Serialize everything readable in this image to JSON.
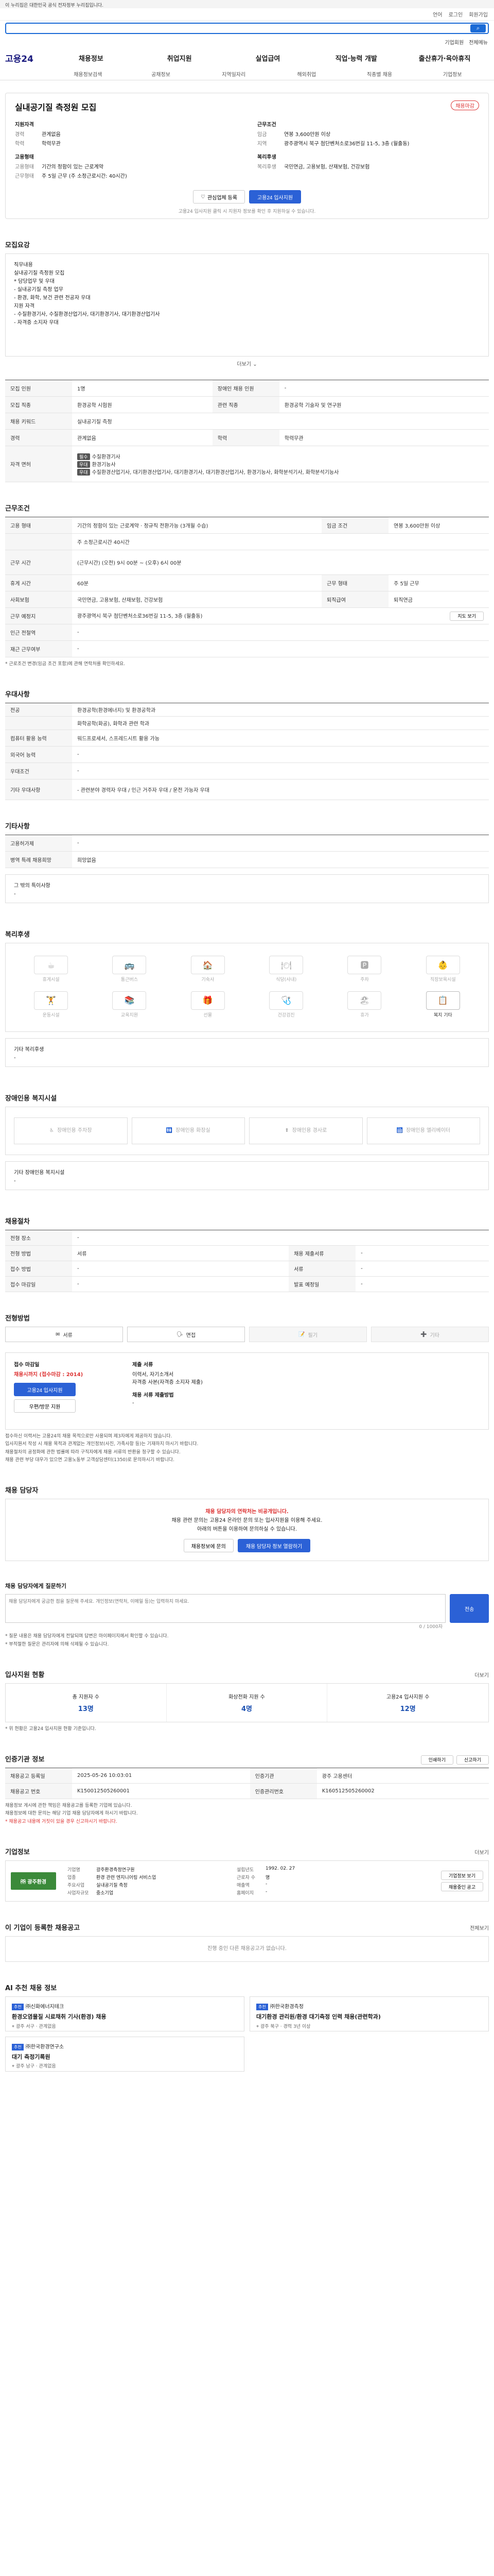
{
  "gov_bar": "이 누리집은 대한민국 공식 전자정부 누리집입니다.",
  "util": {
    "lang": "언어",
    "login": "로그인",
    "join": "회원가입"
  },
  "search": {
    "button": "검색"
  },
  "top_links": {
    "employer": "기업회원",
    "all_menu": "전체메뉴"
  },
  "logo": "고용24",
  "gnb": [
    "채용정보",
    "취업지원",
    "실업급여",
    "직업·능력 개발",
    "출산휴가·육아휴직"
  ],
  "lnb": [
    "채용정보검색",
    "공채정보",
    "지역일자리",
    "해외취업",
    "직종별 채용",
    "기업정보"
  ],
  "job": {
    "title": "실내공기질 측정원 모집",
    "status": "채용마감",
    "left_label": "지원자격",
    "right_label": "근무조건",
    "left_rows": [
      {
        "k": "경력",
        "v": "관계없음"
      },
      {
        "k": "학력",
        "v": "학력무관"
      }
    ],
    "right_rows": [
      {
        "k": "임금",
        "v": "연봉 3,600만원 이상"
      },
      {
        "k": "지역",
        "v": "광주광역시 북구 첨단벤처소로36번길 11-5, 3층 (월출동)"
      }
    ],
    "left_label2": "고용형태",
    "left_rows2": [
      {
        "k": "고용형태",
        "v": "기간의 정함이 있는 근로계약"
      },
      {
        "k": "근무형태",
        "v": "주 5일 근무 (주 소정근로시간: 40시간)"
      }
    ],
    "right_label2": "복리후생",
    "right_rows2": [
      {
        "k": "복리후생",
        "v": "국민연금, 고용보험, 산재보험, 건강보험"
      }
    ],
    "btn_interest": "관심업체 등록",
    "btn_apply": "고용24 입사지원",
    "note": "고용24 입사지원 클릭 시 지원자 정보를 확인 후 지원하실 수 있습니다."
  },
  "sections": {
    "detail": "모집요강",
    "work": "근무조건",
    "qualify": "우대사항",
    "other": "기타사항",
    "benefit": "복리후생",
    "disability": "장애인용 복지시설",
    "apply": "채용절차",
    "method": "전형방법",
    "inquiry": "채용 담당자",
    "question": "채용 담당자에게 질문하기",
    "status": "입사지원 현황",
    "info": "인증기관 정보",
    "company": "기업정보",
    "recommend": "이 기업이 등록한 채용공고",
    "ai": "AI 추천 채용 정보"
  },
  "detail_box": [
    "직무내용",
    "실내공기질 측정원 모집",
    "",
    "* 담당업무 및 우대",
    " - 실내공기질 측정 업무",
    " - 환경, 화학, 보건 관련 전공자 우대",
    "",
    "지원 자격",
    "- 수질환경기사, 수질환경산업기사, 대기환경기사, 대기환경산업기사",
    "- 자격증 소지자 우대"
  ],
  "more": "더보기",
  "table1": [
    {
      "k": "모집 인원",
      "v": "1명",
      "k2": "장애인 채용 인원",
      "v2": "-"
    },
    {
      "k": "모집 직종",
      "v": "환경공학 시험원",
      "k2": "관련 직종",
      "v2": "환경공학 기술자 및 연구원"
    },
    {
      "k": "채용 키워드",
      "v": "실내공기질 측정",
      "k2": "",
      "v2": ""
    },
    {
      "k": "경력",
      "v": "관계없음",
      "k2": "학력",
      "v2": "학력무관"
    }
  ],
  "table1_certs": {
    "k": "자격 면허",
    "rows": [
      {
        "tag": "필수",
        "v": "수질환경기사"
      },
      {
        "tag": "우대",
        "v": "환경기능사"
      },
      {
        "tag": "우대",
        "v": "수질환경산업기사, 대기환경산업기사, 대기환경기사, 대기환경산업기사, 환경기능사, 화학분석기사, 화학분석기능사"
      }
    ]
  },
  "table2": [
    {
      "k": "고용 형태",
      "v": "기간의 정함이 있는 근로계약 · 정규직 전환가능 (3개월 수습)",
      "k2": "임금 조건",
      "v2": "연봉 3,600만원 이상"
    },
    {
      "k": "",
      "v": "주 소정근로시간 40시간",
      "k2": "",
      "v2": ""
    },
    {
      "k": "근무 시간",
      "v": "(근무시간) (오전) 9시 00분 ~ (오후) 6시 00분",
      "k2": "",
      "v2": ""
    },
    {
      "k": "휴게 시간",
      "v": "60분",
      "k2": "근무 형태",
      "v2": "주 5일 근무"
    },
    {
      "k": "사회보험",
      "v": "국민연금, 고용보험, 산재보험, 건강보험",
      "k2": "퇴직급여",
      "v2": "퇴직연금"
    },
    {
      "k": "근무 예정지",
      "v": "광주광역시 북구 첨단벤처소로36번길 11-5, 3층 (월출동)",
      "k2": "",
      "v2": ""
    },
    {
      "k": "인근 전철역",
      "v": "-",
      "k2": "",
      "v2": ""
    },
    {
      "k": "재근 근무여부",
      "v": "-",
      "k2": "",
      "v2": ""
    }
  ],
  "map_button": "지도 보기",
  "work_note": "* 근로조건 변경(임금 조건 포함)에 관해 연락처를 확인하세요.",
  "table3": [
    {
      "k": "전공",
      "v": "환경공학(환경에너지) 및 환경공학과"
    },
    {
      "k": "",
      "v": "화학공학(화공), 화학과 관련 학과"
    },
    {
      "k": "컴퓨터 활용 능력",
      "v": "워드프로세서, 스프레드시트 활용 가능"
    },
    {
      "k": "외국어 능력",
      "v": "-"
    },
    {
      "k": "우대조건",
      "v": "-"
    },
    {
      "k": "기타 우대사항",
      "v": "- 관련분야 경력자 우대 / 인근 거주자 우대 / 운전 가능자 우대"
    }
  ],
  "table4": [
    {
      "k": "고용허가제",
      "v": "-"
    },
    {
      "k": "병역 특례 채용희망",
      "v": "희망없음"
    }
  ],
  "other_label": "그 밖의 특이사항",
  "benefits": [
    {
      "icon": "☕",
      "label": "휴게시설",
      "on": false
    },
    {
      "icon": "🚌",
      "label": "통근버스",
      "on": false
    },
    {
      "icon": "🏠",
      "label": "기숙사",
      "on": false
    },
    {
      "icon": "🍽",
      "label": "식당(사내)",
      "on": false
    },
    {
      "icon": "🅿",
      "label": "주차",
      "on": false
    },
    {
      "icon": "👶",
      "label": "직장보육시설",
      "on": false
    },
    {
      "icon": "🏋",
      "label": "운동시설",
      "on": false
    },
    {
      "icon": "📚",
      "label": "교육지원",
      "on": false
    },
    {
      "icon": "🎁",
      "label": "선물",
      "on": false
    },
    {
      "icon": "🩺",
      "label": "건강검진",
      "on": false
    },
    {
      "icon": "🏖",
      "label": "휴가",
      "on": false
    },
    {
      "icon": "📋",
      "label": "복지 기타",
      "on": true
    }
  ],
  "benefit_other_label": "기타 복리후생",
  "disability": [
    {
      "icon": "♿",
      "label": "장애인용 주차장"
    },
    {
      "icon": "🚻",
      "label": "장애인용 화장실"
    },
    {
      "icon": "⬆",
      "label": "장애인용 경사로"
    },
    {
      "icon": "🛗",
      "label": "장애인용 엘리베이터"
    }
  ],
  "disability_other_label": "기타 장애인용 복지시설",
  "table5": [
    {
      "k": "전형 장소",
      "v": "-",
      "k2": "",
      "v2": ""
    },
    {
      "k": "전형 방법",
      "v": "서류",
      "k2": "채용 제출서류",
      "v2": "-"
    },
    {
      "k": "접수 방법",
      "v": "-",
      "k2": "서류",
      "v2": "-"
    },
    {
      "k": "접수 마감일",
      "v": "-",
      "k2": "발표 예정일",
      "v2": "-"
    }
  ],
  "methods": [
    {
      "icon": "✉",
      "label": "서류",
      "on": true
    },
    {
      "icon": "🗣",
      "label": "면접",
      "on": true
    },
    {
      "icon": "📝",
      "label": "필기",
      "on": false
    },
    {
      "icon": "➕",
      "label": "기타",
      "on": false
    }
  ],
  "apply": {
    "period_label": "접수 마감일",
    "period_value": "채용시까지 (접수마감 : 2014)",
    "btn1": "고용24 입사지원",
    "btn2": "우편/방문 지원",
    "docs_label": "제출 서류",
    "docs": [
      "이력서, 자기소개서",
      "자격증 사본(자격증 소지자 제출)"
    ],
    "contact_label": "채용 서류 제출방법",
    "contact_value": "-"
  },
  "notes": [
    "접수하신 이력서는 고용24의 채용 목적으로만 사용되며 제3자에게 제공하지 않습니다.",
    "입사지원서 작성 시 채용 목적과 관계없는 개인정보(사진, 가족사항 등)는 기재하지 마시기 바랍니다.",
    "채용절차의 공정화에 관한 법률에 따라 구직자에게 채용 서류의 반환을 청구할 수 있습니다.",
    "채용 관련 부당 대우가 있으면 고용노동부 고객상담센터(1350)로 문의하시기 바랍니다."
  ],
  "inquiry": {
    "line1": "채용 담당자의 연락처는 비공개입니다.",
    "line2": "채용 관련 문의는 고용24 온라인 문의 또는 입사지원을 이용해 주세요.",
    "line3": "아래의 버튼을 이용하여 문의하실 수 있습니다.",
    "btn1": "채용정보에 문의",
    "btn2": "채용 담당자 정보 열람하기"
  },
  "question": {
    "placeholder": "채용 담당자에게 궁금한 점을 질문해 주세요. 개인정보(연락처, 이메일 등)는 입력하지 마세요.",
    "counter": "0 / 1000자",
    "btn": "전송",
    "bullets": [
      "* 질문 내용은 채용 담당자에게 전달되며 답변은 마이페이지에서 확인할 수 있습니다.",
      "* 부적절한 질문은 관리자에 의해 삭제될 수 있습니다."
    ]
  },
  "status": {
    "more": "더보기",
    "items": [
      {
        "label": "총 지원자 수",
        "value": "13명"
      },
      {
        "label": "화상전화 지원 수",
        "value": "4명"
      },
      {
        "label": "고용24 입사지원 수",
        "value": "12명"
      }
    ],
    "note": "* 위 현황은 고용24 입사지원 현황 기준입니다."
  },
  "info": {
    "btn_print": "인쇄하기",
    "btn_report": "신고하기",
    "rows": [
      {
        "k": "채용공고 등록일",
        "v": "2025-05-26 10:03:01",
        "k2": "인증기관",
        "v2": "광주 고용센터"
      },
      {
        "k": "채용공고 번호",
        "v": "K150012505260001",
        "k2": "인증관리번호",
        "v2": "K160512505260002"
      }
    ],
    "notes": [
      "채용정보 게시에 관한 책임은 채용공고를 등록한 기업에 있습니다.",
      "채용정보에 대한 문의는 해당 기업 채용 담당자에게 하시기 바랍니다."
    ],
    "note_red": "* 채용공고 내용에 거짓이 있을 경우 신고하시기 바랍니다."
  },
  "company": {
    "logo_text": "㈜ 광주환경",
    "more": "더보기",
    "rows_left": [
      {
        "k": "기업명",
        "v": "광주환경측정연구원"
      },
      {
        "k": "업종",
        "v": "환경 관련 엔지니어링 서비스업"
      },
      {
        "k": "주요사업",
        "v": "실내공기질 측정"
      },
      {
        "k": "사업자규모",
        "v": "중소기업"
      }
    ],
    "rows_right": [
      {
        "k": "설립년도",
        "v": "1992. 02. 27"
      },
      {
        "k": "근로자 수",
        "v": "명"
      },
      {
        "k": "매출액",
        "v": "-"
      },
      {
        "k": "홈페이지",
        "v": "-"
      }
    ],
    "btn1": "기업정보 보기",
    "btn2": "채용중인 공고"
  },
  "recommend": {
    "all": "전체보기",
    "empty": "진행 중인 다른 채용공고가 없습니다."
  },
  "ai": {
    "items": [
      {
        "tag": "추천",
        "company": "㈜신화에너지테크",
        "title": "환경오염물질 시료채취 기사(환경) 채용",
        "sub1": "광주 서구",
        "sub2": "관계없음"
      },
      {
        "tag": "추천",
        "company": "㈜한국환경측정",
        "title": "대기환경 관리원/환경 대기측정 인력 채용(관련학과)",
        "sub1": "광주 북구",
        "sub2": "경력 3년 이상"
      },
      {
        "tag": "추천",
        "company": "㈜한국환경연구소",
        "title": "대기 측정기록원",
        "sub1": "광주 남구",
        "sub2": "관계없음"
      }
    ]
  }
}
